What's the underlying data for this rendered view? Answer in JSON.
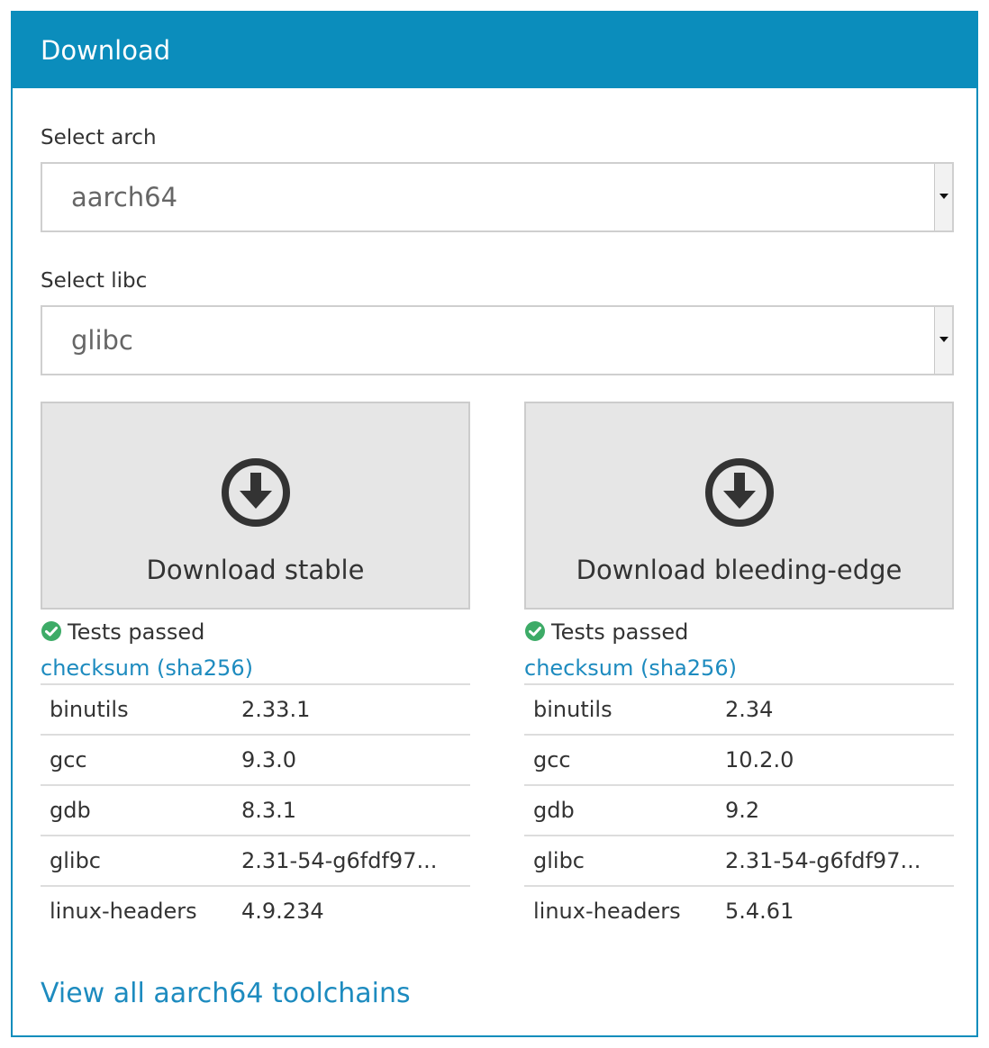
{
  "header": {
    "title": "Download"
  },
  "arch": {
    "label": "Select arch",
    "value": "aarch64"
  },
  "libc": {
    "label": "Select libc",
    "value": "glibc"
  },
  "stable": {
    "button_label": "Download stable",
    "status": "Tests passed",
    "checksum_label": "checksum (sha256)",
    "packages": [
      {
        "name": "binutils",
        "version": "2.33.1"
      },
      {
        "name": "gcc",
        "version": "9.3.0"
      },
      {
        "name": "gdb",
        "version": "8.3.1"
      },
      {
        "name": "glibc",
        "version": "2.31-54-g6fdf97..."
      },
      {
        "name": "linux-headers",
        "version": "4.9.234"
      }
    ]
  },
  "bleeding": {
    "button_label": "Download bleeding-edge",
    "status": "Tests passed",
    "checksum_label": "checksum (sha256)",
    "packages": [
      {
        "name": "binutils",
        "version": "2.34"
      },
      {
        "name": "gcc",
        "version": "10.2.0"
      },
      {
        "name": "gdb",
        "version": "9.2"
      },
      {
        "name": "glibc",
        "version": "2.31-54-g6fdf97..."
      },
      {
        "name": "linux-headers",
        "version": "5.4.61"
      }
    ]
  },
  "footer": {
    "view_all_label": "View all aarch64 toolchains"
  },
  "colors": {
    "accent": "#0b8dbc",
    "link": "#1d8bbf",
    "success": "#3dab67",
    "button_bg": "#e6e6e6"
  },
  "icons": {
    "download": "download-circle-icon",
    "status": "check-circle-icon",
    "select_arrow": "caret-down-icon"
  }
}
